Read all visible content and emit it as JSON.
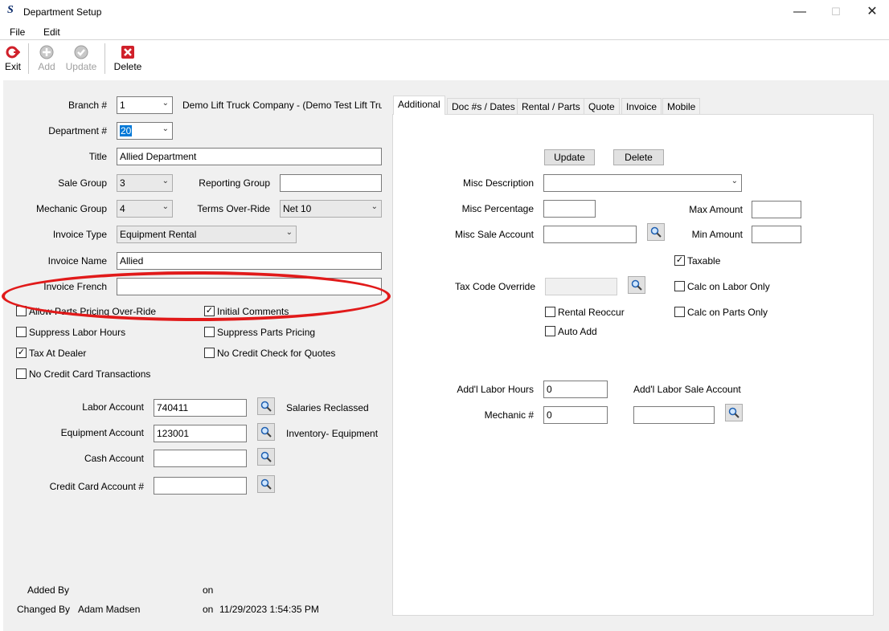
{
  "window": {
    "title": "Department Setup",
    "minimize": "—",
    "maximize": "☐",
    "close": "✕"
  },
  "menu": [
    "File",
    "Edit"
  ],
  "toolbar": {
    "exit": "Exit",
    "add": "Add",
    "update": "Update",
    "delete": "Delete"
  },
  "form": {
    "branch_label": "Branch #",
    "branch_value": "1",
    "branch_company": "Demo Lift Truck Company - (Demo Test Lift Tru",
    "department_label": "Department #",
    "department_value": "20",
    "title_label": "Title",
    "title_value": "Allied Department",
    "sale_group_label": "Sale Group",
    "sale_group_value": "3",
    "reporting_group_label": "Reporting Group",
    "reporting_group_value": "",
    "mechanic_group_label": "Mechanic Group",
    "mechanic_group_value": "4",
    "terms_label": "Terms Over-Ride",
    "terms_value": "Net 10",
    "invoice_type_label": "Invoice Type",
    "invoice_type_value": "Equipment Rental",
    "invoice_name_label": "Invoice Name",
    "invoice_name_value": "Allied",
    "invoice_french_label": "Invoice French",
    "invoice_french_value": ""
  },
  "checkboxes": {
    "allow_parts_pricing": {
      "label": "Allow Parts Pricing Over-Ride",
      "checked": false
    },
    "initial_comments": {
      "label": "Initial Comments",
      "checked": true
    },
    "suppress_labor_hours": {
      "label": "Suppress Labor Hours",
      "checked": false
    },
    "suppress_parts_pricing": {
      "label": "Suppress Parts Pricing",
      "checked": false
    },
    "tax_at_dealer": {
      "label": "Tax At Dealer",
      "checked": true
    },
    "no_credit_check": {
      "label": "No Credit Check for Quotes",
      "checked": false
    },
    "no_credit_card": {
      "label": "No Credit Card Transactions",
      "checked": false
    }
  },
  "accounts": {
    "labor_label": "Labor Account",
    "labor_value": "740411",
    "labor_desc": "Salaries Reclassed",
    "equipment_label": "Equipment Account",
    "equipment_value": "123001",
    "equipment_desc": "Inventory- Equipment",
    "cash_label": "Cash Account",
    "cash_value": "",
    "credit_card_label": "Credit Card Account #",
    "credit_card_value": ""
  },
  "audit": {
    "added_by_label": "Added By",
    "added_on_label": "on",
    "changed_by_label": "Changed By",
    "changed_by_value": "Adam Madsen",
    "changed_on_label": "on",
    "changed_on_value": "11/29/2023 1:54:35 PM"
  },
  "tabs": [
    "Additional",
    "Doc #s / Dates",
    "Rental / Parts",
    "Quote",
    "Invoice",
    "Mobile"
  ],
  "additional": {
    "update_btn": "Update",
    "delete_btn": "Delete",
    "misc_desc_label": "Misc Description",
    "misc_desc_value": "",
    "misc_pct_label": "Misc Percentage",
    "misc_pct_value": "",
    "max_amount_label": "Max Amount",
    "max_amount_value": "",
    "misc_sale_label": "Misc Sale Account",
    "misc_sale_value": "",
    "min_amount_label": "Min Amount",
    "min_amount_value": "",
    "taxable_label": "Taxable",
    "taxable_checked": true,
    "tax_code_label": "Tax Code Override",
    "tax_code_value": "",
    "calc_labor_label": "Calc on Labor Only",
    "rental_reoccur_label": "Rental Reoccur",
    "calc_parts_label": "Calc on Parts Only",
    "auto_add_label": "Auto Add",
    "addl_labor_hours_label": "Add'l Labor Hours",
    "addl_labor_hours_value": "0",
    "addl_labor_sale_label": "Add'l Labor Sale Account",
    "mechanic_label": "Mechanic #",
    "mechanic_value": "0",
    "addl_labor_sale_value": ""
  },
  "colors": {
    "annotation": "#e11a1a",
    "selection": "#0078d7"
  }
}
